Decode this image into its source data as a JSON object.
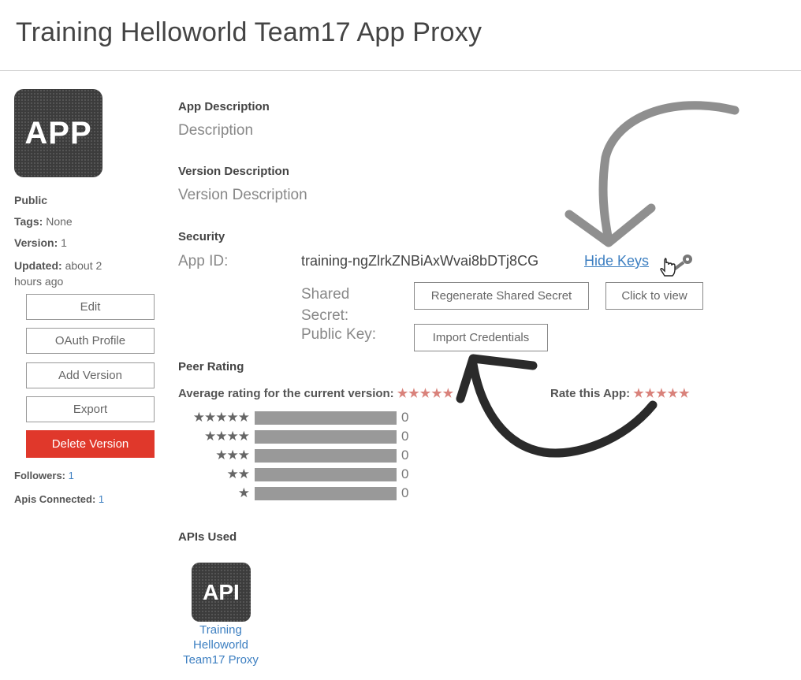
{
  "page": {
    "title": "Training Helloworld Team17 App Proxy"
  },
  "sidebar": {
    "icon_text": "APP",
    "visibility": "Public",
    "tags_label": "Tags:",
    "tags_value": "None",
    "version_label": "Version:",
    "version_value": "1",
    "updated_label": "Updated:",
    "updated_value_1": "about 2",
    "updated_value_2": "hours ago",
    "buttons": {
      "edit": "Edit",
      "oauth": "OAuth Profile",
      "add_version": "Add Version",
      "export": "Export",
      "delete": "Delete Version"
    },
    "followers_label": "Followers:",
    "followers_value": "1",
    "apis_label": "Apis Connected:",
    "apis_value": "1"
  },
  "main": {
    "app_description_label": "App Description",
    "app_description_value": "Description",
    "version_description_label": "Version Description",
    "version_description_value": "Version Description",
    "security_label": "Security",
    "app_id_label": "App ID:",
    "app_id_value": "training-ngZlrkZNBiAxWvai8bDTj8CG",
    "hide_keys": "Hide Keys",
    "shared_secret_label_1": "Shared",
    "shared_secret_label_2": "Secret:",
    "regenerate_button": "Regenerate Shared Secret",
    "click_to_view_button": "Click to view",
    "public_key_label": "Public Key:",
    "import_button": "Import Credentials",
    "peer_rating_label": "Peer Rating",
    "avg_rating_label": "Average rating for the current version:",
    "avg_rating_stars": "★★★★★",
    "rate_app_label": "Rate this App:",
    "rate_app_stars": "★★★★★",
    "distribution": [
      {
        "stars": "★★★★★",
        "count": "0"
      },
      {
        "stars": "★★★★",
        "count": "0"
      },
      {
        "stars": "★★★",
        "count": "0"
      },
      {
        "stars": "★★",
        "count": "0"
      },
      {
        "stars": "★",
        "count": "0"
      }
    ],
    "apis_used_label": "APIs Used",
    "api_icon_text": "API",
    "api_name_1": "Training",
    "api_name_2": "Helloworld",
    "api_name_3": "Team17 Proxy"
  },
  "icons": [
    "app-icon",
    "api-icon",
    "key-icon",
    "hand-cursor-icon",
    "star-icon",
    "annotation-arrow"
  ],
  "colors": {
    "danger": "#e0382b",
    "link": "#3d7fc1",
    "star": "#d9827b",
    "bar": "#999999"
  }
}
